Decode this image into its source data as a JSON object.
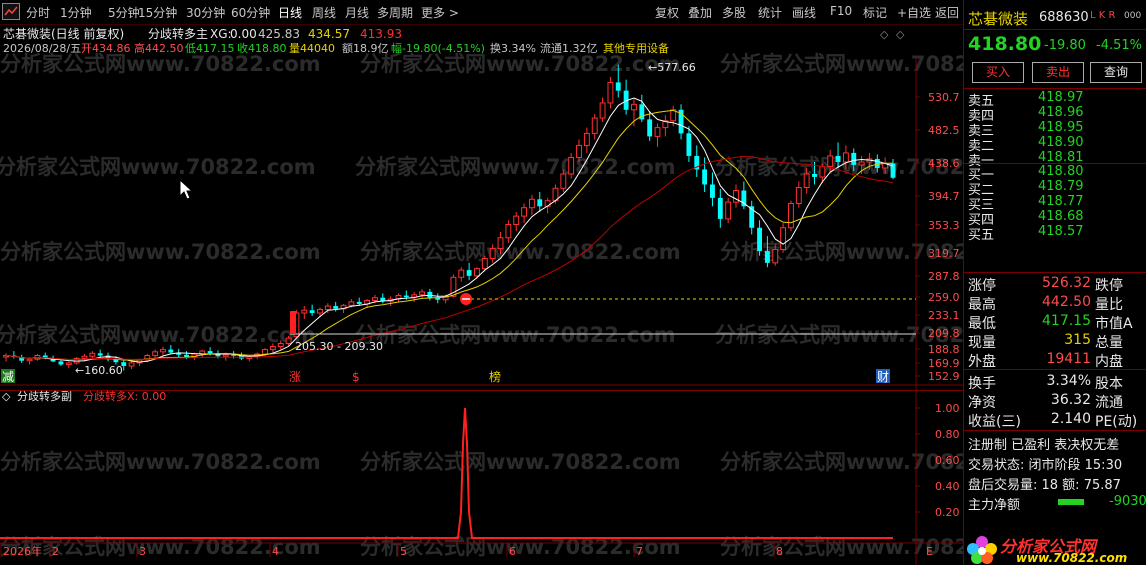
{
  "toolbar": {
    "items": [
      "分时",
      "1分钟",
      "5分钟",
      "15分钟",
      "30分钟",
      "60分钟",
      "日线",
      "周线",
      "月线",
      "多周期",
      "更多 >"
    ],
    "right_items": [
      "复权",
      "叠加",
      "多股",
      "统计",
      "画线",
      "F10",
      "标记",
      "+自选",
      "返回"
    ]
  },
  "header": {
    "title": "芯碁微装(日线 前复权)",
    "indicator_name": "分歧转多主",
    "xg_label": "XG:",
    "xg_value": "0.00",
    "v1": "425.83",
    "v2": "434.57",
    "v3": "413.93",
    "info_date": "2026/08/28/五",
    "info_open": "开434.86",
    "info_high": "高442.50",
    "info_low": "低417.15",
    "info_close": "收418.80",
    "info_vol": "量44040",
    "info_amt": "额18.9亿",
    "info_chg": "幅-19.80(-4.51%)",
    "info_turn": "换3.34%",
    "info_float": "流通1.32亿",
    "info_other": "其他专用设备"
  },
  "price_axis": [
    "530.7",
    "482.5",
    "438.6",
    "394.7",
    "353.3",
    "319.7",
    "287.8",
    "259.0",
    "233.1",
    "209.8",
    "188.8",
    "169.9",
    "152.9"
  ],
  "annotations": {
    "peak_label": "577.66",
    "low_label": "160.60",
    "range_label": "205.30 - 209.30"
  },
  "event_markers": [
    "减",
    "涨",
    "$",
    "榜",
    "财"
  ],
  "sub_chart": {
    "title": "分歧转多副",
    "label": "分歧转多X: 0.00",
    "axis": [
      "1.00",
      "0.80",
      "0.60",
      "0.40",
      "0.20"
    ]
  },
  "time_axis": [
    "2026年",
    "2",
    "3",
    "4",
    "5",
    "6",
    "7",
    "8"
  ],
  "time_axis_right": "E",
  "watermark_text": "分析家公式网www.70822.com",
  "panel": {
    "stock_name": "芯碁微装",
    "code": "688630",
    "tags": "L K R",
    "tag_num": "000",
    "price": "418.80",
    "change": "-19.80",
    "change_pct": "-4.51%",
    "buttons": [
      "买入",
      "卖出",
      "查询"
    ],
    "asks": [
      {
        "label": "卖五",
        "price": "418.97"
      },
      {
        "label": "卖四",
        "price": "418.96"
      },
      {
        "label": "卖三",
        "price": "418.95"
      },
      {
        "label": "卖二",
        "price": "418.90"
      },
      {
        "label": "卖一",
        "price": "418.81"
      }
    ],
    "bids": [
      {
        "label": "买一",
        "price": "418.80"
      },
      {
        "label": "买二",
        "price": "418.79"
      },
      {
        "label": "买三",
        "price": "418.77"
      },
      {
        "label": "买四",
        "price": "418.68"
      },
      {
        "label": "买五",
        "price": "418.57"
      }
    ],
    "stats": [
      {
        "label": "涨停",
        "value": "526.32",
        "label2": "跌停"
      },
      {
        "label": "最高",
        "value": "442.50",
        "label2": "量比"
      },
      {
        "label": "最低",
        "value": "417.15",
        "label2": "市值A"
      },
      {
        "label": "现量",
        "value": "315",
        "label2": "总量"
      },
      {
        "label": "外盘",
        "value": "19411",
        "label2": "内盘"
      }
    ],
    "stats2": [
      {
        "label": "换手",
        "value": "3.34%",
        "label2": "股本"
      },
      {
        "label": "净资",
        "value": "36.32",
        "label2": "流通"
      },
      {
        "label": "收益(三)",
        "value": "2.140",
        "label2": "PE(动)"
      }
    ],
    "notes": [
      "注册制 已盈利 表决权无差",
      "交易状态: 闭市阶段 15:30",
      "盘后交易量: 18  额: 75.87"
    ],
    "main_flow_label": "主力净额",
    "main_flow_value": "-9030",
    "logo_text": "分析家公式网",
    "logo_url": "www.70822.com"
  },
  "colors": {
    "up": "#ff3030",
    "down": "#00ffff",
    "ma1": "#ffffff",
    "ma2": "#e6d200",
    "ma3": "#c00000",
    "grid": "#7a0000"
  },
  "chart_data": {
    "type": "candlestick",
    "ma_lines": [
      "white",
      "yellow",
      "red"
    ],
    "candles": [
      [
        178,
        183,
        172,
        180
      ],
      [
        180,
        186,
        176,
        178
      ],
      [
        178,
        181,
        170,
        173
      ],
      [
        173,
        177,
        168,
        175
      ],
      [
        175,
        182,
        173,
        180
      ],
      [
        180,
        184,
        175,
        176
      ],
      [
        176,
        180,
        171,
        172
      ],
      [
        172,
        176,
        166,
        168
      ],
      [
        168,
        172,
        163,
        170
      ],
      [
        170,
        178,
        168,
        176
      ],
      [
        176,
        182,
        172,
        179
      ],
      [
        179,
        186,
        176,
        183
      ],
      [
        183,
        188,
        177,
        180
      ],
      [
        180,
        184,
        172,
        175
      ],
      [
        175,
        179,
        168,
        171
      ],
      [
        171,
        174,
        160,
        166
      ],
      [
        166,
        172,
        162,
        170
      ],
      [
        170,
        176,
        166,
        174
      ],
      [
        174,
        182,
        171,
        180
      ],
      [
        180,
        188,
        177,
        185
      ],
      [
        185,
        192,
        180,
        188
      ],
      [
        188,
        194,
        182,
        184
      ],
      [
        184,
        189,
        178,
        181
      ],
      [
        181,
        186,
        175,
        178
      ],
      [
        178,
        184,
        174,
        182
      ],
      [
        182,
        188,
        178,
        186
      ],
      [
        186,
        191,
        180,
        183
      ],
      [
        183,
        187,
        176,
        179
      ],
      [
        179,
        184,
        173,
        181
      ],
      [
        181,
        186,
        176,
        180
      ],
      [
        180,
        184,
        174,
        176
      ],
      [
        176,
        181,
        172,
        178
      ],
      [
        178,
        184,
        175,
        182
      ],
      [
        182,
        190,
        180,
        188
      ],
      [
        188,
        196,
        184,
        192
      ],
      [
        192,
        200,
        188,
        196
      ],
      [
        196,
        206,
        193,
        203
      ],
      [
        205,
        240,
        204,
        236
      ],
      [
        236,
        246,
        228,
        240
      ],
      [
        240,
        248,
        232,
        236
      ],
      [
        236,
        244,
        230,
        241
      ],
      [
        241,
        250,
        236,
        246
      ],
      [
        246,
        252,
        238,
        242
      ],
      [
        242,
        249,
        236,
        247
      ],
      [
        247,
        256,
        244,
        252
      ],
      [
        252,
        258,
        246,
        249
      ],
      [
        249,
        256,
        243,
        254
      ],
      [
        254,
        262,
        250,
        258
      ],
      [
        258,
        264,
        250,
        253
      ],
      [
        253,
        260,
        246,
        256
      ],
      [
        256,
        264,
        252,
        261
      ],
      [
        261,
        268,
        255,
        259
      ],
      [
        259,
        266,
        252,
        262
      ],
      [
        262,
        270,
        258,
        266
      ],
      [
        266,
        270,
        254,
        258
      ],
      [
        258,
        264,
        250,
        255
      ],
      [
        255,
        262,
        250,
        260
      ],
      [
        260,
        290,
        258,
        286
      ],
      [
        286,
        300,
        280,
        296
      ],
      [
        296,
        306,
        282,
        288
      ],
      [
        288,
        300,
        284,
        298
      ],
      [
        298,
        316,
        294,
        312
      ],
      [
        312,
        330,
        306,
        325
      ],
      [
        325,
        345,
        318,
        338
      ],
      [
        338,
        360,
        332,
        354
      ],
      [
        354,
        372,
        346,
        366
      ],
      [
        366,
        384,
        356,
        378
      ],
      [
        378,
        396,
        368,
        390
      ],
      [
        390,
        400,
        372,
        380
      ],
      [
        380,
        392,
        370,
        388
      ],
      [
        388,
        410,
        384,
        405
      ],
      [
        405,
        430,
        400,
        424
      ],
      [
        424,
        452,
        418,
        446
      ],
      [
        446,
        470,
        440,
        462
      ],
      [
        462,
        486,
        452,
        478
      ],
      [
        478,
        506,
        470,
        500
      ],
      [
        500,
        530,
        494,
        522
      ],
      [
        522,
        560,
        514,
        552
      ],
      [
        552,
        578,
        530,
        540
      ],
      [
        540,
        556,
        505,
        512
      ],
      [
        512,
        528,
        488,
        520
      ],
      [
        520,
        534,
        494,
        498
      ],
      [
        498,
        510,
        468,
        474
      ],
      [
        474,
        492,
        460,
        486
      ],
      [
        486,
        504,
        474,
        496
      ],
      [
        496,
        518,
        488,
        512
      ],
      [
        512,
        520,
        470,
        478
      ],
      [
        478,
        488,
        440,
        448
      ],
      [
        448,
        462,
        420,
        430
      ],
      [
        430,
        446,
        400,
        410
      ],
      [
        410,
        426,
        380,
        392
      ],
      [
        392,
        404,
        350,
        362
      ],
      [
        362,
        392,
        356,
        386
      ],
      [
        386,
        410,
        378,
        402
      ],
      [
        402,
        414,
        376,
        380
      ],
      [
        380,
        388,
        342,
        350
      ],
      [
        350,
        360,
        316,
        322
      ],
      [
        322,
        340,
        300,
        306
      ],
      [
        306,
        330,
        302,
        324
      ],
      [
        324,
        356,
        320,
        350
      ],
      [
        350,
        388,
        346,
        384
      ],
      [
        384,
        414,
        378,
        406
      ],
      [
        406,
        432,
        398,
        424
      ],
      [
        424,
        440,
        410,
        420
      ],
      [
        420,
        438,
        412,
        434
      ],
      [
        434,
        456,
        426,
        448
      ],
      [
        448,
        466,
        432,
        440
      ],
      [
        440,
        462,
        430,
        452
      ],
      [
        452,
        458,
        428,
        436
      ],
      [
        436,
        448,
        424,
        440
      ],
      [
        440,
        452,
        430,
        444
      ],
      [
        444,
        450,
        426,
        432
      ],
      [
        432,
        446,
        424,
        438
      ],
      [
        438,
        444,
        417,
        419
      ]
    ]
  }
}
